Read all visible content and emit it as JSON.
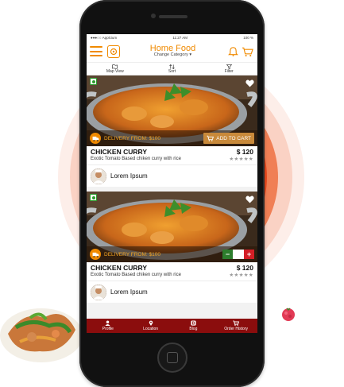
{
  "status": {
    "carrier": "●●●○○ Applcium",
    "time": "11:27 AM",
    "battery": "100 %"
  },
  "header": {
    "title": "Home Food",
    "subtitle": "Change Category ▾"
  },
  "toolbar": [
    {
      "label": "Map View",
      "icon": "map-icon"
    },
    {
      "label": "Sort",
      "icon": "sort-icon"
    },
    {
      "label": "Filter",
      "icon": "filter-icon"
    }
  ],
  "cards": [
    {
      "delivery": "DELIVERY FROM: $100",
      "action": "ADD TO CART",
      "name": "CHICKEN CURRY",
      "price": "$ 120",
      "desc": "Exotic Tomato Based chiken curry with rice",
      "rating": "★★★★★",
      "chef": "Lorem Ipsum"
    },
    {
      "delivery": "DELIVERY FROM: $100",
      "action": "quantity-stepper",
      "name": "CHICKEN CURRY",
      "price": "$ 120",
      "desc": "Exotic Tomato Based chiken curry with rice",
      "rating": "★★★★★",
      "chef": "Lorem Ipsum"
    }
  ],
  "stepper": {
    "minus": "−",
    "plus": "+"
  },
  "nav": [
    {
      "label": "Profile",
      "icon": "user-icon"
    },
    {
      "label": "Location",
      "icon": "location-pin-icon"
    },
    {
      "label": "Blog",
      "icon": "blog-icon"
    },
    {
      "label": "Order History",
      "icon": "cart-icon"
    }
  ],
  "colors": {
    "accent": "#f08a00",
    "nav_bg": "#8b0d0d",
    "add_to_cart": "#c8893a",
    "glow": "#ea4a1e"
  }
}
